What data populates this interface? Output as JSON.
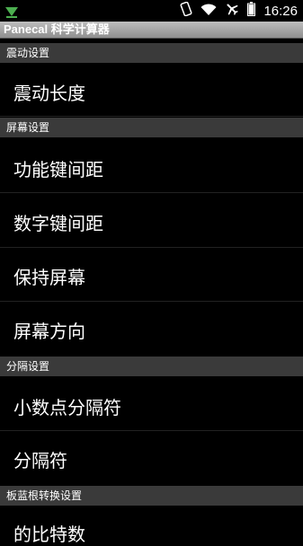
{
  "status_bar": {
    "time": "16:26",
    "icons": [
      "download-notification-icon",
      "vibrate-icon",
      "wifi-icon",
      "airplane-icon",
      "battery-icon"
    ]
  },
  "app": {
    "title": "Panecal 科学计算器"
  },
  "sections": [
    {
      "header": "震动设置",
      "items": [
        "震动长度"
      ]
    },
    {
      "header": "屏幕设置",
      "items": [
        "功能键间距",
        "数字键间距",
        "保持屏幕",
        "屏幕方向"
      ]
    },
    {
      "header": "分隔设置",
      "items": [
        "小数点分隔符",
        "分隔符"
      ]
    },
    {
      "header": "板蓝根转换设置",
      "items": [
        "的比特数"
      ]
    }
  ],
  "colors": {
    "background": "#000000",
    "section_header": "#3a3a3a",
    "title_bar": "#a6a6a6",
    "text": "#ffffff"
  }
}
